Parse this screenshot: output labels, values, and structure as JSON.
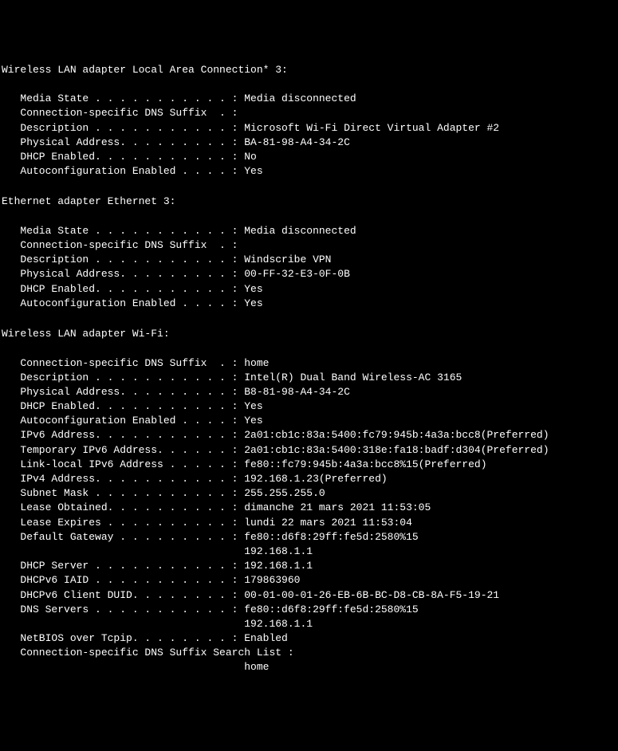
{
  "adapters": [
    {
      "header": "Wireless LAN adapter Local Area Connection* 3:",
      "properties": [
        {
          "label": "   Media State . . . . . . . . . . . : ",
          "value": "Media disconnected"
        },
        {
          "label": "   Connection-specific DNS Suffix  . :",
          "value": ""
        },
        {
          "label": "   Description . . . . . . . . . . . : ",
          "value": "Microsoft Wi-Fi Direct Virtual Adapter #2"
        },
        {
          "label": "   Physical Address. . . . . . . . . : ",
          "value": "BA-81-98-A4-34-2C"
        },
        {
          "label": "   DHCP Enabled. . . . . . . . . . . : ",
          "value": "No"
        },
        {
          "label": "   Autoconfiguration Enabled . . . . : ",
          "value": "Yes"
        }
      ]
    },
    {
      "header": "Ethernet adapter Ethernet 3:",
      "properties": [
        {
          "label": "   Media State . . . . . . . . . . . : ",
          "value": "Media disconnected"
        },
        {
          "label": "   Connection-specific DNS Suffix  . :",
          "value": ""
        },
        {
          "label": "   Description . . . . . . . . . . . : ",
          "value": "Windscribe VPN"
        },
        {
          "label": "   Physical Address. . . . . . . . . : ",
          "value": "00-FF-32-E3-0F-0B"
        },
        {
          "label": "   DHCP Enabled. . . . . . . . . . . : ",
          "value": "Yes"
        },
        {
          "label": "   Autoconfiguration Enabled . . . . : ",
          "value": "Yes"
        }
      ]
    },
    {
      "header": "Wireless LAN adapter Wi-Fi:",
      "properties": [
        {
          "label": "   Connection-specific DNS Suffix  . : ",
          "value": "home"
        },
        {
          "label": "   Description . . . . . . . . . . . : ",
          "value": "Intel(R) Dual Band Wireless-AC 3165"
        },
        {
          "label": "   Physical Address. . . . . . . . . : ",
          "value": "B8-81-98-A4-34-2C"
        },
        {
          "label": "   DHCP Enabled. . . . . . . . . . . : ",
          "value": "Yes"
        },
        {
          "label": "   Autoconfiguration Enabled . . . . : ",
          "value": "Yes"
        },
        {
          "label": "   IPv6 Address. . . . . . . . . . . : ",
          "value": "2a01:cb1c:83a:5400:fc79:945b:4a3a:bcc8(Preferred)"
        },
        {
          "label": "   Temporary IPv6 Address. . . . . . : ",
          "value": "2a01:cb1c:83a:5400:318e:fa18:badf:d304(Preferred)"
        },
        {
          "label": "   Link-local IPv6 Address . . . . . : ",
          "value": "fe80::fc79:945b:4a3a:bcc8%15(Preferred)"
        },
        {
          "label": "   IPv4 Address. . . . . . . . . . . : ",
          "value": "192.168.1.23(Preferred)"
        },
        {
          "label": "   Subnet Mask . . . . . . . . . . . : ",
          "value": "255.255.255.0"
        },
        {
          "label": "   Lease Obtained. . . . . . . . . . : ",
          "value": "dimanche 21 mars 2021 11:53:05"
        },
        {
          "label": "   Lease Expires . . . . . . . . . . : ",
          "value": "lundi 22 mars 2021 11:53:04"
        },
        {
          "label": "   Default Gateway . . . . . . . . . : ",
          "value": "fe80::d6f8:29ff:fe5d:2580%15"
        },
        {
          "label": "                                       ",
          "value": "192.168.1.1"
        },
        {
          "label": "   DHCP Server . . . . . . . . . . . : ",
          "value": "192.168.1.1"
        },
        {
          "label": "   DHCPv6 IAID . . . . . . . . . . . : ",
          "value": "179863960"
        },
        {
          "label": "   DHCPv6 Client DUID. . . . . . . . : ",
          "value": "00-01-00-01-26-EB-6B-BC-D8-CB-8A-F5-19-21"
        },
        {
          "label": "   DNS Servers . . . . . . . . . . . : ",
          "value": "fe80::d6f8:29ff:fe5d:2580%15"
        },
        {
          "label": "                                       ",
          "value": "192.168.1.1"
        },
        {
          "label": "   NetBIOS over Tcpip. . . . . . . . : ",
          "value": "Enabled"
        },
        {
          "label": "   Connection-specific DNS Suffix Search List :",
          "value": ""
        },
        {
          "label": "                                       ",
          "value": "home"
        }
      ]
    }
  ]
}
